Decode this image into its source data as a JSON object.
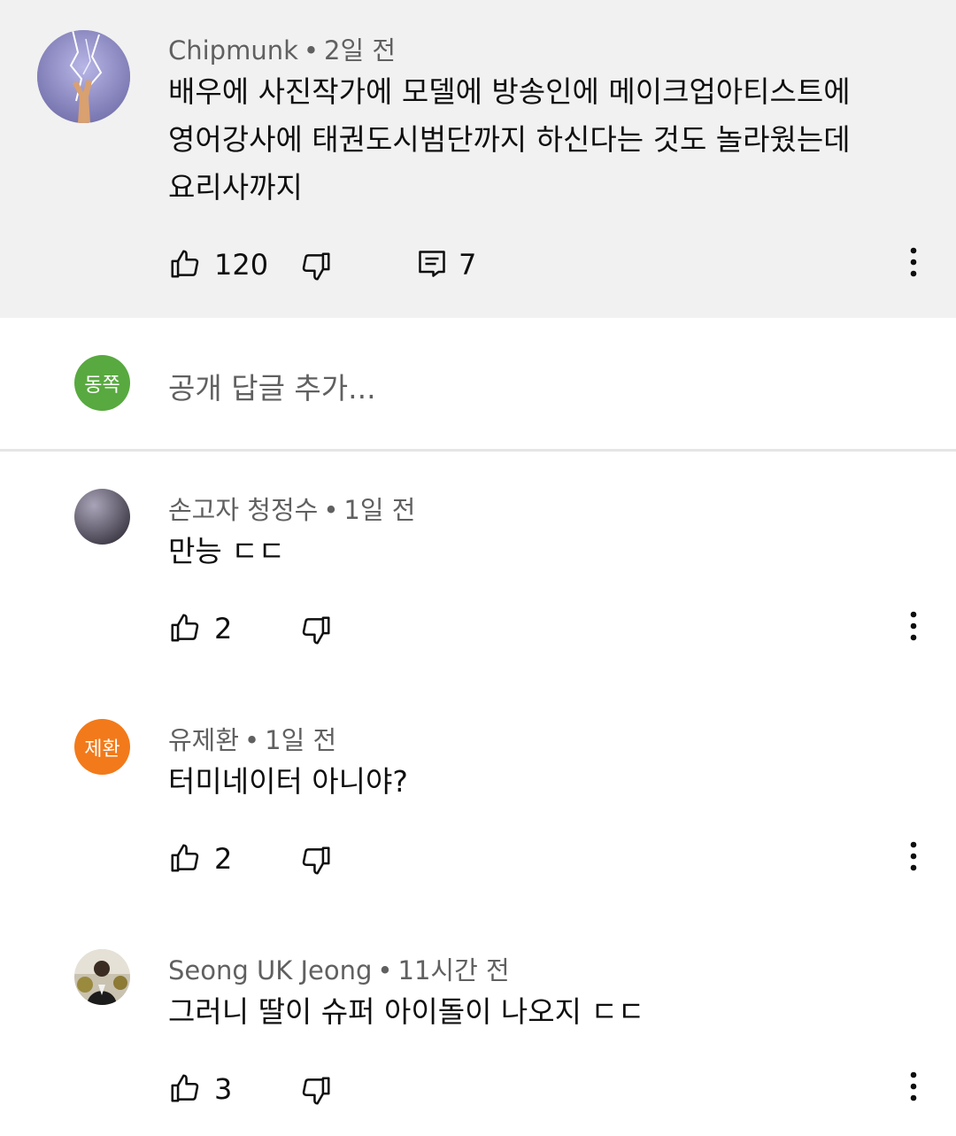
{
  "comments": [
    {
      "author": "Chipmunk",
      "time": "2일 전",
      "lines": [
        "배우에 사진작가에 모델에 방송인에 메이크업아티스트에",
        "영어강사에 태권도시범단까지 하신다는 것도 놀라웠는데",
        "요리사까지"
      ],
      "likes": "120",
      "replies": "7",
      "avatar_icon": "lightning-hand-photo"
    },
    {
      "author": "손고자 청정수",
      "time": "1일 전",
      "lines": [
        "만능 ㄷㄷ"
      ],
      "likes": "2",
      "avatar_icon": "dark-sphere-photo"
    },
    {
      "author": "유제환",
      "time": "1일 전",
      "lines": [
        "터미네이터 아니야?"
      ],
      "likes": "2",
      "avatar_text": "제환",
      "avatar_color": "#f27a1a"
    },
    {
      "author": "Seong UK Jeong",
      "time": "11시간 전",
      "lines": [
        "그러니 딸이 슈퍼 아이돌이 나오지 ㄷㄷ"
      ],
      "likes": "3",
      "avatar_icon": "person-photo"
    }
  ],
  "reply_box": {
    "avatar_text": "동쪽",
    "avatar_color": "#58a93f",
    "placeholder": "공개 답글 추가..."
  },
  "separator": "•",
  "colors": {
    "highlight_bg": "#f1f1f1",
    "meta_text": "#606060",
    "text": "#0f0f0f"
  }
}
